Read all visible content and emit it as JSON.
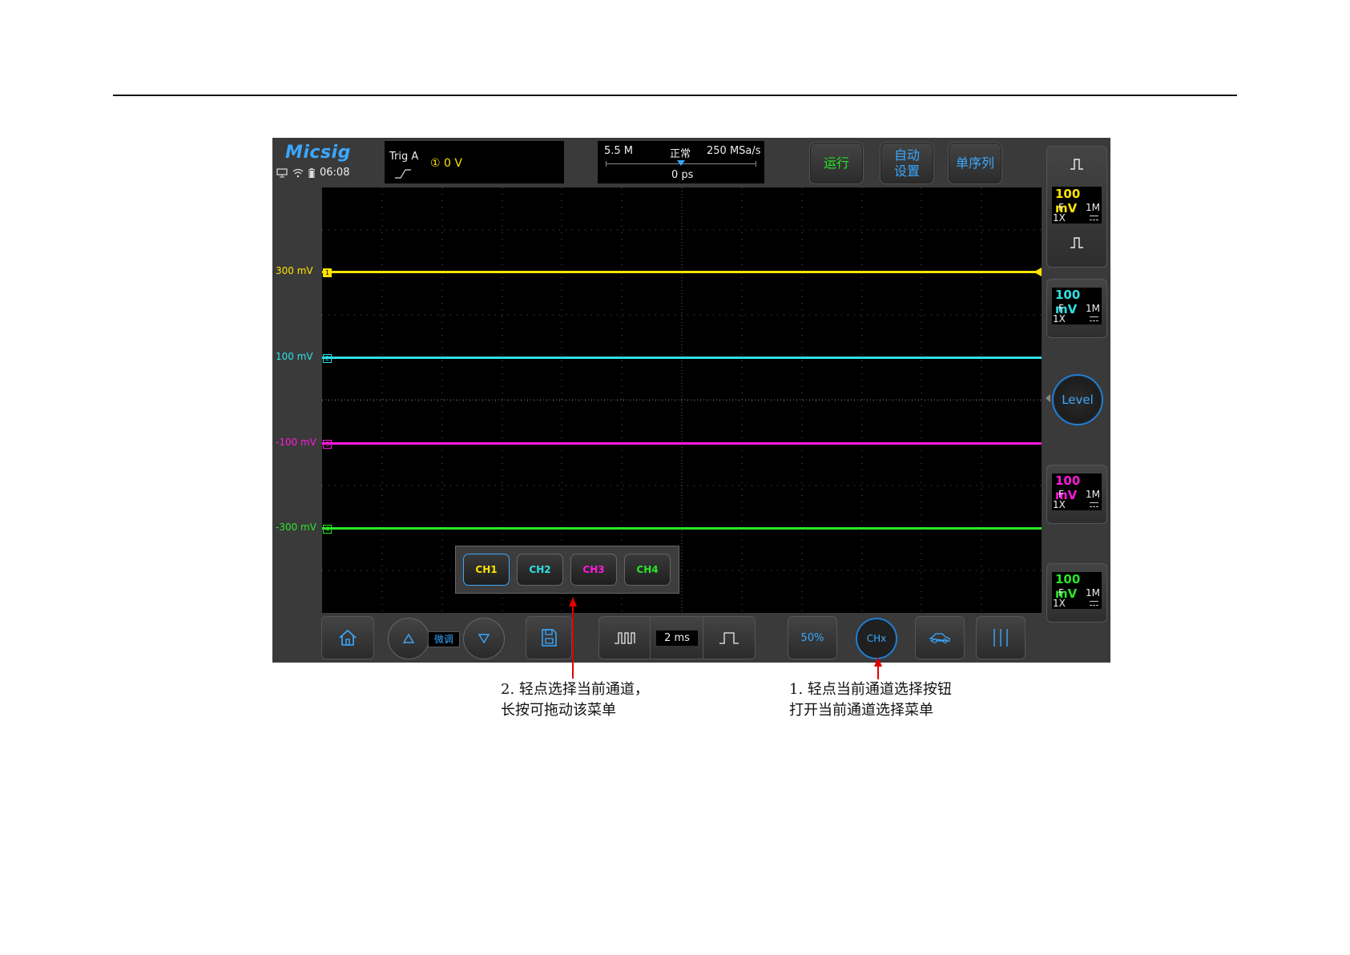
{
  "brand": "Micsig",
  "status_time": "06:08",
  "trigger": {
    "label": "Trig  A",
    "source_level": "① 0 V"
  },
  "timebase": {
    "memory": "5.5 M",
    "mode": "正常",
    "sample_rate": "250 MSa/s",
    "position": "0 ps"
  },
  "top_buttons": {
    "run": "运行",
    "auto_line1": "自动",
    "auto_line2": "设置",
    "single": "单序列"
  },
  "channels": [
    {
      "name": "CH1",
      "offset_label": "300 mV",
      "tag": "1",
      "scale": "100 mV",
      "coupling": "F",
      "impedance": "1M",
      "probe": "1X",
      "color": "#ffe400"
    },
    {
      "name": "CH2",
      "offset_label": "100 mV",
      "tag": "2",
      "scale": "100 mV",
      "coupling": "F",
      "impedance": "1M",
      "probe": "1X",
      "color": "#2ee0e6"
    },
    {
      "name": "CH3",
      "offset_label": "-100 mV",
      "tag": "3",
      "scale": "100 mV",
      "coupling": "F",
      "impedance": "1M",
      "probe": "1X",
      "color": "#ff1adc"
    },
    {
      "name": "CH4",
      "offset_label": "-300 mV",
      "tag": "4",
      "scale": "100 mV",
      "coupling": "F",
      "impedance": "1M",
      "probe": "1X",
      "color": "#29e629"
    }
  ],
  "level_button": "Level",
  "bottom": {
    "fine_tune": "微调",
    "timebase_value": "2 ms",
    "fifty_percent": "50%",
    "chx": "CHx"
  },
  "annotations": {
    "note2": "2. 轻点选择当前通道，\n长按可拖动该菜单",
    "note1": "1. 轻点当前通道选择按钮\n打开当前通道选择菜单"
  },
  "colors": {
    "accent_blue": "#3aa8ff",
    "run_green": "#22e622",
    "arrow_red": "#e00000"
  }
}
